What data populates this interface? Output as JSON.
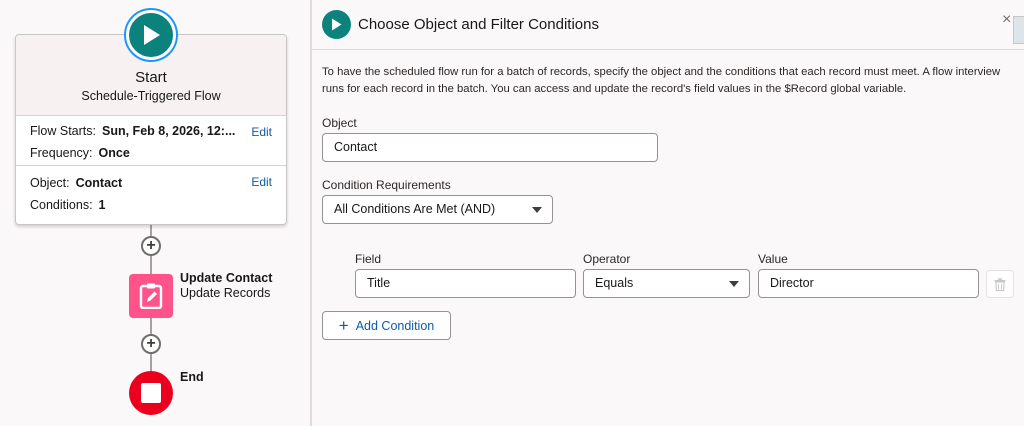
{
  "canvas": {
    "start": {
      "title": "Start",
      "subtitle": "Schedule-Triggered Flow",
      "flow_starts_label": "Flow Starts:",
      "flow_starts_value": "Sun, Feb 8, 2026, 12:...",
      "frequency_label": "Frequency:",
      "frequency_value": "Once",
      "object_label": "Object:",
      "object_value": "Contact",
      "conditions_label": "Conditions:",
      "conditions_value": "1",
      "edit_label": "Edit"
    },
    "update": {
      "title": "Update Contact",
      "subtitle": "Update Records"
    },
    "end": {
      "label": "End"
    },
    "add_icon": "+"
  },
  "panel": {
    "title": "Choose Object and Filter Conditions",
    "close_icon": "×",
    "description_line1": "To have the scheduled flow run for a batch of records, specify the object and the conditions that each record must meet. A flow interview",
    "description_line2": "runs for each record in the batch. You can access and update the record's field values in the $Record global variable.",
    "object_label": "Object",
    "object_value": "Contact",
    "condition_req_label": "Condition Requirements",
    "condition_req_value": "All Conditions Are Met (AND)",
    "condition": {
      "field_label": "Field",
      "field_value": "Title",
      "operator_label": "Operator",
      "operator_value": "Equals",
      "value_label": "Value",
      "value_value": "Director"
    },
    "add_condition_label": "Add Condition",
    "add_condition_icon": "+"
  },
  "colors": {
    "start_teal": "#0b827c",
    "update_pink": "#ff538a",
    "end_red": "#ea001e",
    "link_blue": "#0b5cab"
  },
  "icons": [
    "play-icon",
    "edit-records-icon",
    "stop-icon",
    "add-icon",
    "close-icon",
    "trash-icon",
    "chevron-down-icon"
  ]
}
